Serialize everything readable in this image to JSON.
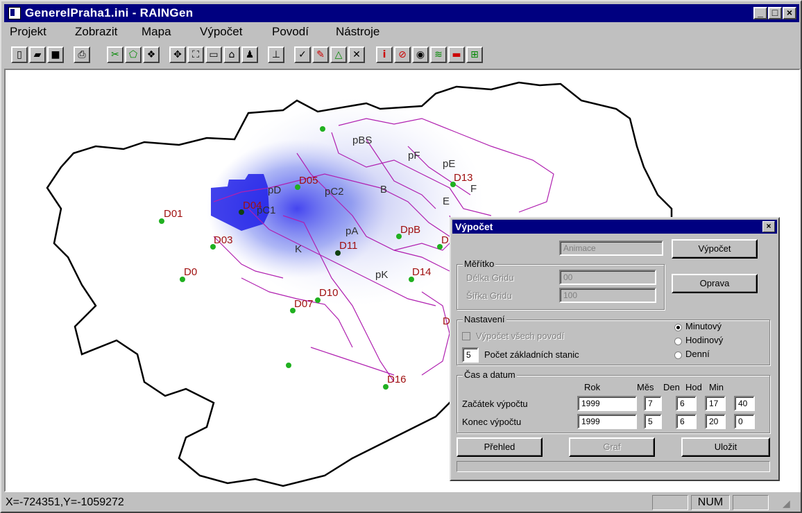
{
  "window": {
    "title": "GenerelPraha1.ini - RAINGen"
  },
  "menu": [
    "Projekt",
    "Zobrazit",
    "Mapa",
    "Výpočet",
    "Povodí",
    "Nástroje"
  ],
  "map": {
    "stations": [
      "D01",
      "D04",
      "D05",
      "D03",
      "D0",
      "D07",
      "D10",
      "D11",
      "D13",
      "D14",
      "D16",
      "DpB",
      "D",
      "D"
    ],
    "basins": [
      "pBS",
      "pF",
      "pE",
      "F",
      "pD",
      "pC2",
      "B",
      "E",
      "pC1",
      "pA",
      "K",
      "pK"
    ]
  },
  "dialog": {
    "title": "Výpočet",
    "close": "×",
    "animace_field": "Animace",
    "vypocet_button": "Výpočet",
    "meritko": {
      "label": "Měřítko",
      "delka_label": "Délka Gridu",
      "delka_value": "00",
      "sirka_label": "Šířka Gridu",
      "sirka_value": "100"
    },
    "oprava_button": "Oprava",
    "nastaveni": {
      "label": "Nastavení",
      "vsech_label": "Výpočet všech povodí",
      "pocet_value": "5",
      "pocet_label": "Počet základních stanic",
      "radios": [
        "Minutový",
        "Hodinový",
        "Denní"
      ]
    },
    "cas": {
      "label": "Čas a datum",
      "col_rok": "Rok",
      "col_mes": "Měs",
      "col_den": "Den",
      "col_hod": "Hod",
      "col_min": "Min",
      "zacatek_label": "Začátek výpočtu",
      "zacatek": [
        "1999",
        "7",
        "6",
        "17",
        "40"
      ],
      "konec_label": "Konec výpočtu",
      "konec": [
        "1999",
        "5",
        "6",
        "20",
        "0"
      ]
    },
    "prehled_button": "Přehled",
    "graf_button": "Graf",
    "ulozit_button": "Uložit"
  },
  "status": {
    "coords": "X=-724351,Y=-1059272",
    "num": "NUM"
  }
}
